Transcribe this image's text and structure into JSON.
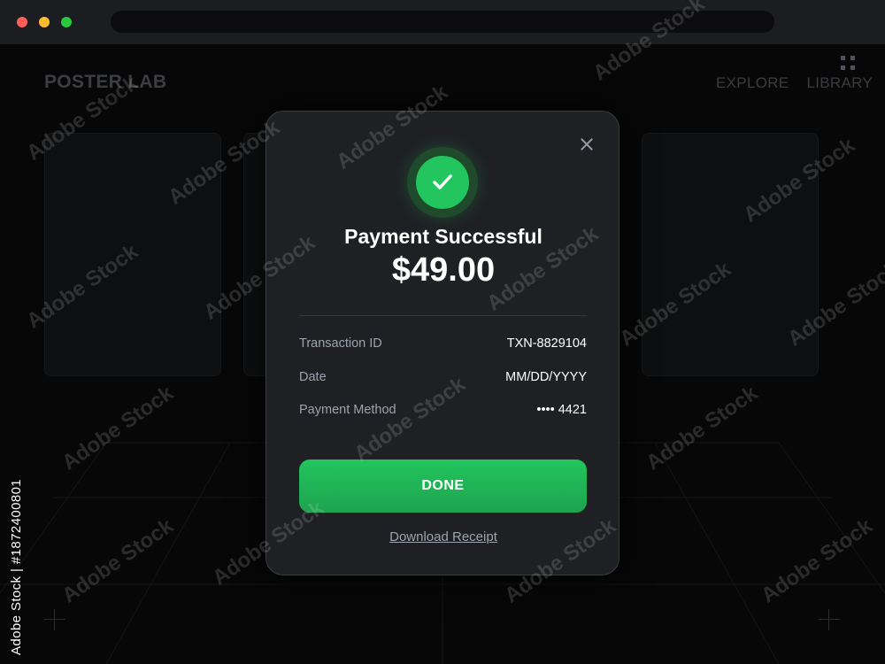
{
  "app": {
    "brand": "POSTER LAB",
    "nav": [
      "EXPLORE",
      "LIBRARY"
    ]
  },
  "modal": {
    "title": "Payment Successful",
    "amount": "$49.00",
    "details": [
      {
        "label": "Transaction ID",
        "value": "TXN-8829104"
      },
      {
        "label": "Date",
        "value": "MM/DD/YYYY"
      },
      {
        "label": "Payment Method",
        "value": "•••• 4421"
      }
    ],
    "done_label": "DONE",
    "receipt_label": "Download Receipt"
  },
  "watermark": {
    "text": "Adobe Stock",
    "stock_id": "Adobe Stock | #1872400801"
  },
  "colors": {
    "success": "#22c55e",
    "modal_bg": "#1f2024",
    "page_bg": "#070707"
  }
}
